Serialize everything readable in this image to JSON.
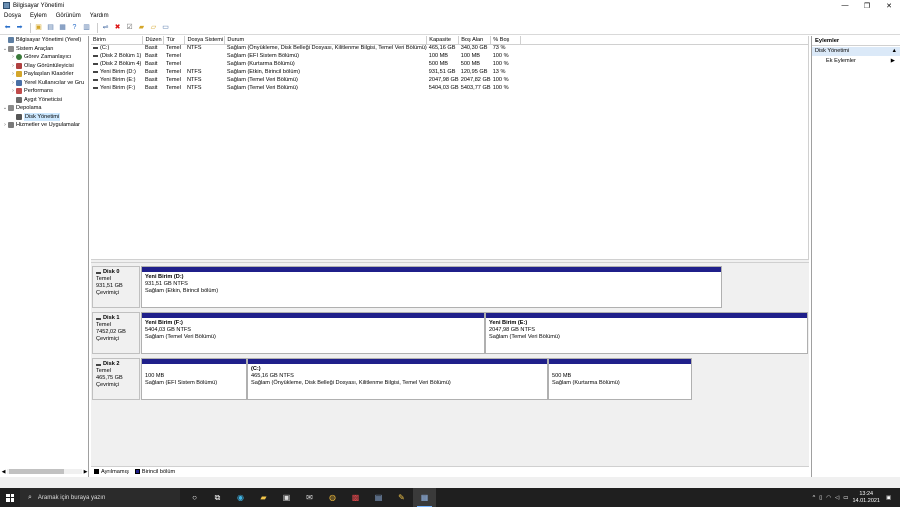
{
  "window": {
    "title": "Bilgisayar Yönetimi",
    "controls": {
      "minimize": "—",
      "maximize": "❐",
      "close": "✕"
    }
  },
  "menu": [
    "Dosya",
    "Eylem",
    "Görünüm",
    "Yardım"
  ],
  "toolbar": {
    "icons": [
      "back-icon",
      "forward-icon",
      "up-folder-icon",
      "console-tree-icon",
      "properties-icon",
      "help-icon",
      "help-pane-icon",
      "connect-icon",
      "delete-icon",
      "checklist-icon",
      "open-folder-icon",
      "new-folder-icon",
      "view-icon"
    ]
  },
  "tree": {
    "items": [
      {
        "label": "Bilgisayar Yönetimi (Yerel)",
        "level": 0,
        "expander": "",
        "color": "#5e7fa3"
      },
      {
        "label": "Sistem Araçları",
        "level": 1,
        "expander": "⌄",
        "color": "#8a8a8a"
      },
      {
        "label": "Görev Zamanlayıcı",
        "level": 2,
        "expander": "›",
        "color": "#3a7a3a"
      },
      {
        "label": "Olay Görüntüleyicisi",
        "level": 2,
        "expander": "›",
        "color": "#b04040"
      },
      {
        "label": "Paylaşılan Klasörler",
        "level": 2,
        "expander": "›",
        "color": "#d4a62a"
      },
      {
        "label": "Yerel Kullanıcılar ve Gru",
        "level": 2,
        "expander": "›",
        "color": "#4a6fa5"
      },
      {
        "label": "Performans",
        "level": 2,
        "expander": "›",
        "color": "#c04a4a"
      },
      {
        "label": "Aygıt Yöneticisi",
        "level": 2,
        "expander": "",
        "color": "#6b6b6b"
      },
      {
        "label": "Depolama",
        "level": 1,
        "expander": "⌄",
        "color": "#8a8a8a"
      },
      {
        "label": "Disk Yönetimi",
        "level": 2,
        "expander": "",
        "color": "#555555",
        "selected": true
      },
      {
        "label": "Hizmetler ve Uygulamalar",
        "level": 1,
        "expander": "›",
        "color": "#7a7a7a"
      }
    ]
  },
  "volumes": {
    "headers": [
      "Birim",
      "Düzen",
      "Tür",
      "Dosya Sistemi",
      "Durum",
      "Kapasite",
      "Boş Alan",
      "% Boş"
    ],
    "rows": [
      [
        "(C:)",
        "Basit",
        "Temel",
        "NTFS",
        "Sağlam (Önyükleme, Disk Belleği Dosyası, Kilitlenme Bilgisi, Temel Veri Bölümü)",
        "465,16 GB",
        "340,30 GB",
        "73 %"
      ],
      [
        "(Disk 2 Bölüm 1)",
        "Basit",
        "Temel",
        "",
        "Sağlam (EFI Sistem Bölümü)",
        "100 MB",
        "100 MB",
        "100 %"
      ],
      [
        "(Disk 2 Bölüm 4)",
        "Basit",
        "Temel",
        "",
        "Sağlam (Kurtarma Bölümü)",
        "500 MB",
        "500 MB",
        "100 %"
      ],
      [
        "Yeni Birim (D:)",
        "Basit",
        "Temel",
        "NTFS",
        "Sağlam (Etkin, Birincil bölüm)",
        "931,51 GB",
        "120,95 GB",
        "13 %"
      ],
      [
        "Yeni Birim (E:)",
        "Basit",
        "Temel",
        "NTFS",
        "Sağlam (Temel Veri Bölümü)",
        "2047,98 GB",
        "2047,82 GB",
        "100 %"
      ],
      [
        "Yeni Birim (F:)",
        "Basit",
        "Temel",
        "NTFS",
        "Sağlam (Temel Veri Bölümü)",
        "5404,03 GB",
        "5403,77 GB",
        "100 %"
      ]
    ]
  },
  "disks": [
    {
      "name": "Disk 0",
      "type": "Temel",
      "size": "931,51 GB",
      "status": "Çevrimiçi",
      "partitions": [
        {
          "title": "Yeni Birim  (D:)",
          "size": "931,51 GB NTFS",
          "status": "Sağlam (Etkin, Birincil bölüm)"
        }
      ]
    },
    {
      "name": "Disk 1",
      "type": "Temel",
      "size": "7452,02 GB",
      "status": "Çevrimiçi",
      "partitions": [
        {
          "title": "Yeni Birim  (F:)",
          "size": "5404,03 GB NTFS",
          "status": "Sağlam (Temel Veri Bölümü)"
        },
        {
          "title": "Yeni Birim  (E:)",
          "size": "2047,98 GB NTFS",
          "status": "Sağlam (Temel Veri Bölümü)"
        }
      ]
    },
    {
      "name": "Disk 2",
      "type": "Temel",
      "size": "465,75 GB",
      "status": "Çevrimiçi",
      "partitions": [
        {
          "title": "",
          "size": "100 MB",
          "status": "Sağlam (EFI Sistem Bölümü)"
        },
        {
          "title": "(C:)",
          "size": "465,16 GB NTFS",
          "status": "Sağlam (Önyükleme, Disk Belleği Dosyası, Kilitlenme Bilgisi, Temel Veri Bölümü)"
        },
        {
          "title": "",
          "size": "500 MB",
          "status": "Sağlam (Kurtarma Bölümü)"
        }
      ]
    }
  ],
  "legend": [
    {
      "label": "Ayrılmamış",
      "color": "#000000"
    },
    {
      "label": "Birincil bölüm",
      "color": "#1f1f8a"
    }
  ],
  "actions": {
    "header": "Eylemler",
    "section": "Disk Yönetimi",
    "section_arrow": "▲",
    "items": [
      {
        "label": "Ek Eylemler",
        "arrow": "▶"
      }
    ]
  },
  "taskbar": {
    "search_placeholder": "Aramak için buraya yazın",
    "apps": [
      "cortana-icon",
      "task-view-icon",
      "edge-icon",
      "file-explorer-icon",
      "store-icon",
      "mail-icon",
      "chrome-icon",
      "outlook-icon",
      "remote-desktop-icon",
      "pencil-app-icon",
      "computer-management-icon"
    ],
    "tray": {
      "chevron": "^",
      "time": "13:24",
      "date": "14.01.2021"
    }
  },
  "colors": {
    "primary_partition": "#1f1f8a",
    "selection": "#cce8ff",
    "actions_section": "#dbe9f8",
    "taskbar": "#1f1f1f"
  }
}
